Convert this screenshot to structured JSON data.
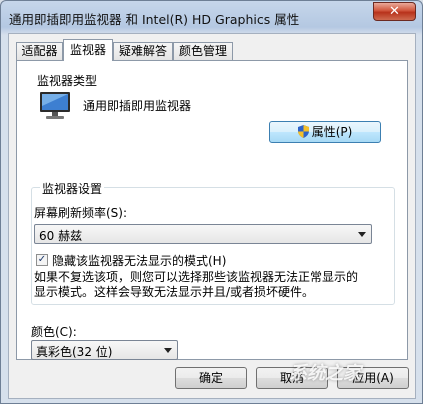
{
  "window": {
    "title": "通用即插即用监视器 和 Intel(R) HD Graphics 属性",
    "close_label": "✕"
  },
  "tabs": [
    {
      "label": "适配器"
    },
    {
      "label": "监视器"
    },
    {
      "label": "疑难解答"
    },
    {
      "label": "颜色管理"
    }
  ],
  "monitor_type": {
    "group_label": "监视器类型",
    "monitor_name": "通用即插即用监视器",
    "properties_button": "属性(P)",
    "icon": "monitor-icon",
    "shield_icon": "uac-shield-icon"
  },
  "monitor_settings": {
    "group_label": "监视器设置",
    "refresh_label": "屏幕刷新频率(S):",
    "refresh_value": "60 赫兹",
    "hide_modes_label": "隐藏该监视器无法显示的模式(H)",
    "hide_modes_checked": true,
    "description_line1": "如果不复选该项，则您可以选择那些该监视器无法正常显示的",
    "description_line2": "显示模式。这样会导致无法显示并且/或者损坏硬件。"
  },
  "color": {
    "label": "颜色(C):",
    "value": "真彩色(32 位)"
  },
  "footer": {
    "ok": "确定",
    "cancel": "取消",
    "apply": "应用(A)"
  },
  "watermark": "系统之家"
}
